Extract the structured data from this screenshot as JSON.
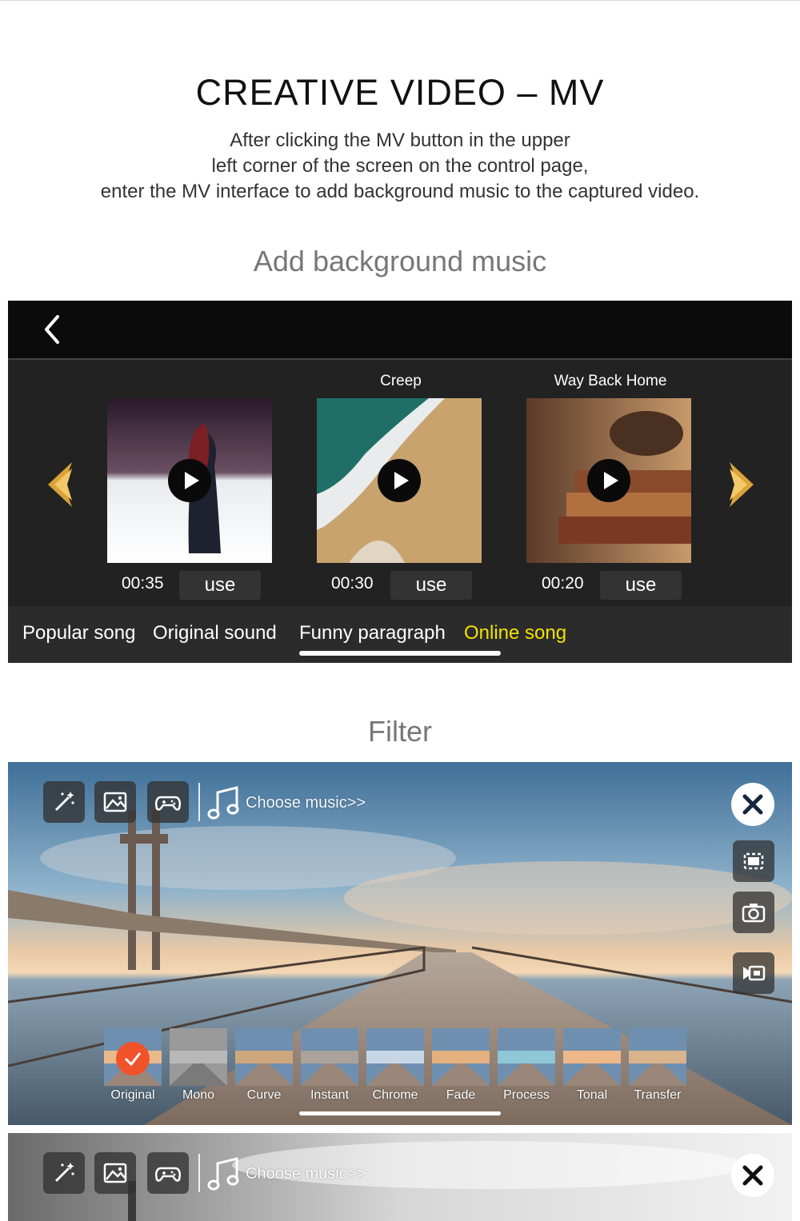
{
  "header": {
    "title": "CREATIVE VIDEO – MV",
    "desc_line1": "After clicking the MV button in the upper",
    "desc_line2": "left corner of the screen on the control page,",
    "desc_line3": "enter the MV interface to add background music to the captured video."
  },
  "sections": {
    "music_title": "Add background music",
    "filter_title": "Filter"
  },
  "mv": {
    "back_icon": "chevron-left-icon",
    "songs": [
      {
        "title": "",
        "duration": "00:35",
        "use_label": "use"
      },
      {
        "title": "Creep",
        "duration": "00:30",
        "use_label": "use"
      },
      {
        "title": "Way Back Home",
        "duration": "00:20",
        "use_label": "use"
      }
    ],
    "tabs": [
      "Popular song",
      "Original sound",
      "Funny paragraph",
      "Online song"
    ],
    "active_tab_color": "#f2e200",
    "arrow_color": "#d9a23a"
  },
  "filter": {
    "choose_music": "Choose music>>",
    "tools": [
      "magic-wand-icon",
      "image-icon",
      "gamepad-icon"
    ],
    "right_tools": [
      "close-icon",
      "frame-icon",
      "camera-icon",
      "video-icon"
    ],
    "filters": [
      "Original",
      "Mono",
      "Curve",
      "Instant",
      "Chrome",
      "Fade",
      "Process",
      "Tonal",
      "Transfer"
    ],
    "selected_filter": "Original",
    "check_color": "#f0522a"
  },
  "filter2": {
    "choose_music": "Choose music>>"
  }
}
